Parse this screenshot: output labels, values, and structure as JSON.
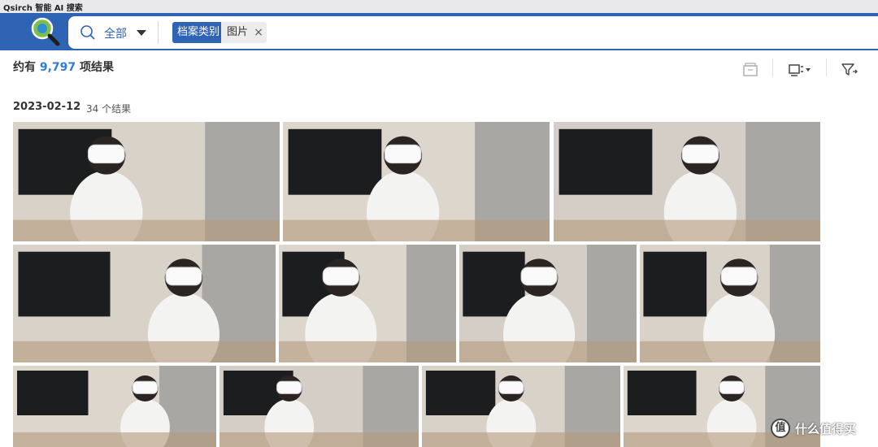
{
  "app": {
    "title": "Qsirch 智能 AI 搜索"
  },
  "search": {
    "scope_label": "全部",
    "filter_key": "档案类别",
    "filter_value": "图片",
    "remove_symbol": "×"
  },
  "results": {
    "prefix": "约有",
    "count": "9,797",
    "suffix": "项结果"
  },
  "group": {
    "date": "2023-02-12",
    "count_label": "34 个结果"
  },
  "photos": [
    {
      "label": "vr-photo-1"
    },
    {
      "label": "vr-photo-2"
    },
    {
      "label": "vr-photo-3"
    },
    {
      "label": "vr-photo-4"
    },
    {
      "label": "vr-photo-5"
    },
    {
      "label": "vr-photo-6"
    },
    {
      "label": "vr-photo-7"
    },
    {
      "label": "vr-photo-8"
    },
    {
      "label": "vr-photo-9"
    },
    {
      "label": "vr-photo-10"
    },
    {
      "label": "vr-photo-11"
    }
  ],
  "watermark": {
    "glyph": "值",
    "text": "什么值得买"
  },
  "colors": {
    "brand": "#2f64b4",
    "accent_count": "#2f7dd1"
  }
}
